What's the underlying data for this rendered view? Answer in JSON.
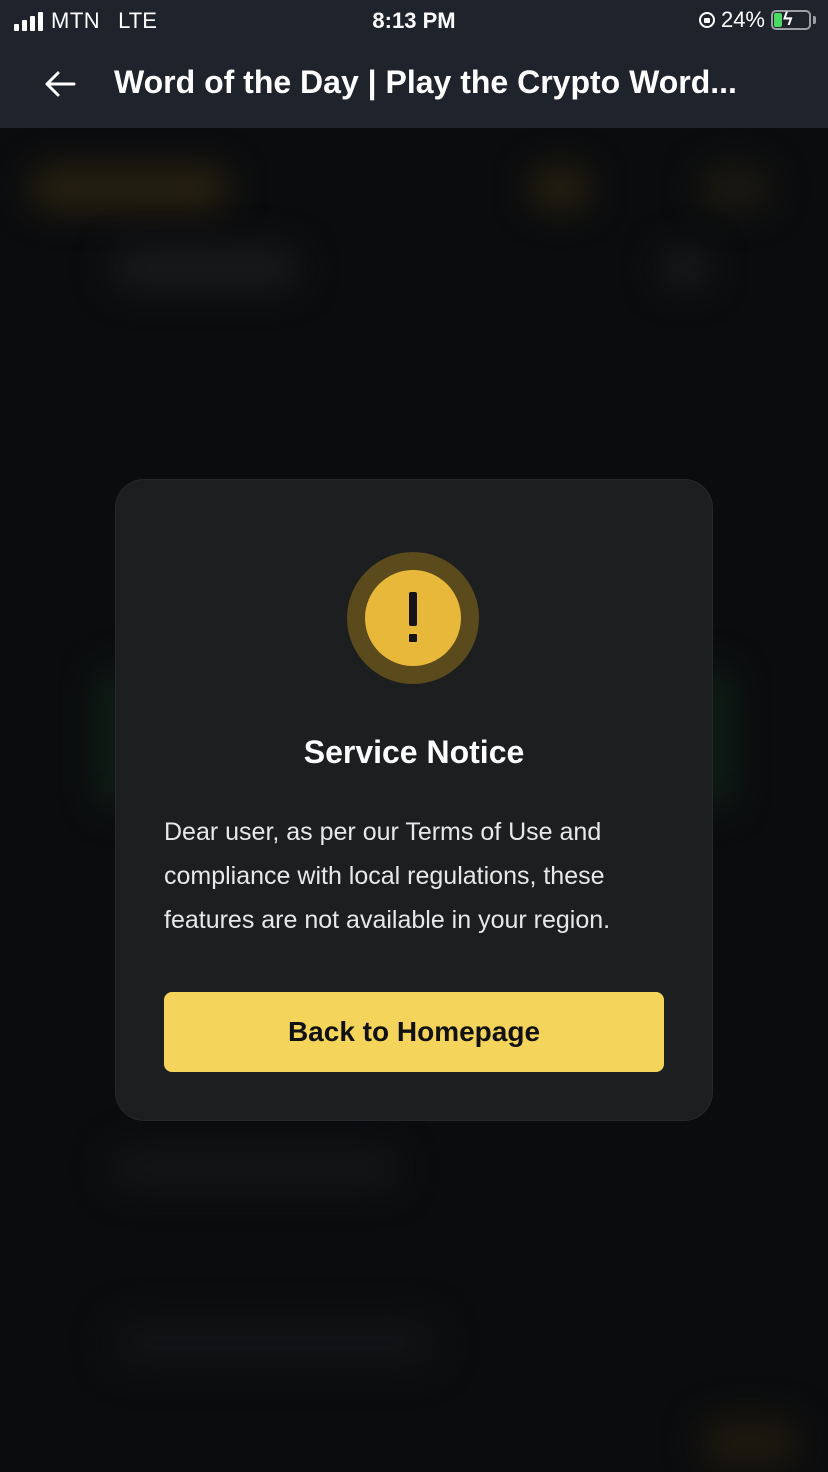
{
  "status_bar": {
    "carrier": "MTN",
    "network": "LTE",
    "time": "8:13 PM",
    "battery_percent": "24%",
    "battery_level": 0.24,
    "charging": true
  },
  "header": {
    "back_icon": "arrow-left-icon",
    "title": "Word of the Day | Play the Crypto Word..."
  },
  "modal": {
    "icon": "warning-icon",
    "icon_colors": {
      "outer": "#5a4a1c",
      "inner": "#e8b83a"
    },
    "title": "Service Notice",
    "message": "Dear user, as per our Terms of Use and compliance with local regulations, these features are not available in your region.",
    "button_label": "Back to Homepage",
    "button_color": "#f5d45c"
  },
  "colors": {
    "background": "#0b0c0e",
    "header_background": "#1f232b",
    "modal_background": "#1d1e20"
  }
}
